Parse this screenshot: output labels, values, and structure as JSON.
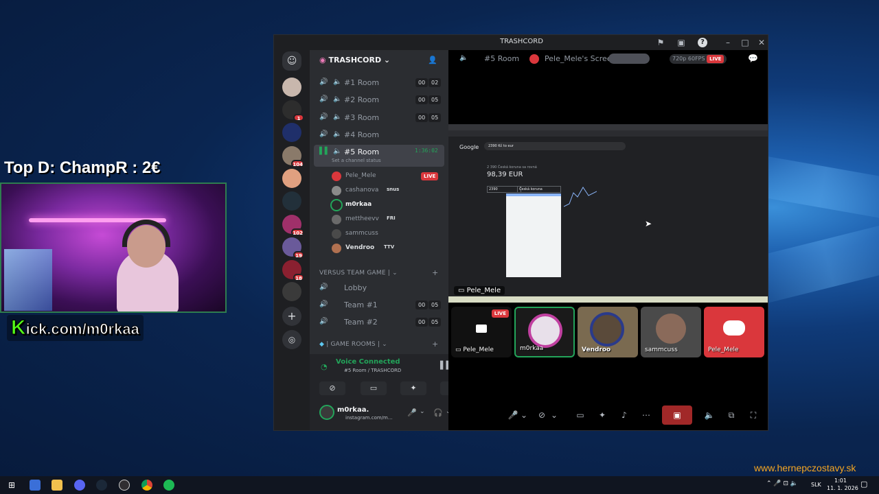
{
  "overlay": {
    "title": "Top D: ChampR : 2€",
    "kick_k": "K",
    "kick_rest": "ick.com/m0rkaa",
    "website": "www.hernepczostavy.sk"
  },
  "window": {
    "title": "TRASHCORD"
  },
  "servers": [
    {
      "badge": ""
    },
    {
      "badge": "1"
    },
    {
      "badge": ""
    },
    {
      "badge": "104"
    },
    {
      "badge": ""
    },
    {
      "badge": ""
    },
    {
      "badge": "102"
    },
    {
      "badge": "19"
    },
    {
      "badge": "18"
    },
    {
      "badge": ""
    }
  ],
  "sidebar": {
    "guild_name": "TRASHCORD",
    "channels": [
      {
        "name": "#1 Room",
        "count_a": "00",
        "count_b": "02"
      },
      {
        "name": "#2 Room",
        "count_a": "00",
        "count_b": "05"
      },
      {
        "name": "#3 Room",
        "count_a": "00",
        "count_b": "05"
      },
      {
        "name": "#4 Room",
        "count_a": "",
        "count_b": ""
      }
    ],
    "active_channel": {
      "name": "#5 Room",
      "timer": "1:36:02",
      "status": "Set a channel status"
    },
    "voice_users": [
      {
        "name": "Pele_Mele",
        "tag": "LIVE"
      },
      {
        "name": "cashanova",
        "tag": "snus"
      },
      {
        "name": "m0rkaa",
        "tag": ""
      },
      {
        "name": "mettheevv",
        "tag": "FRI"
      },
      {
        "name": "sammcuss",
        "tag": ""
      },
      {
        "name": "Vendroo",
        "tag": "TTV"
      }
    ],
    "category_versus": "VERSUS TEAM GAME |",
    "versus_channels": [
      {
        "name": "Lobby",
        "count_a": "",
        "count_b": ""
      },
      {
        "name": "Team #1",
        "count_a": "00",
        "count_b": "05"
      },
      {
        "name": "Team #2",
        "count_a": "00",
        "count_b": "05"
      }
    ],
    "category_game": "| GAME ROOMS |"
  },
  "voice": {
    "status": "Voice Connected",
    "location": "#5 Room / TRASHCORD"
  },
  "user": {
    "name": "m0rkaa.",
    "subtitle": "instagram.com/m..."
  },
  "stage": {
    "channel": "#5 Room",
    "stream_title": "Pele_Mele's Screen",
    "quality": "720p 60FPS",
    "live": "LIVE",
    "stream_owner": "Pele_Mele",
    "inner": {
      "search": "2390 Kč to eur",
      "result_label": "2 390 Česká koruna sa rovná",
      "result_value": "98,39 EUR",
      "input_value": "2390",
      "currency": "Česká koruna",
      "google": "Google"
    }
  },
  "tiles": [
    {
      "name": "Pele_Mele",
      "live": "LIVE"
    },
    {
      "name": "m0rkaa",
      "live": ""
    },
    {
      "name": "Vendroo",
      "live": ""
    },
    {
      "name": "sammcuss",
      "live": ""
    },
    {
      "name": "Pele_Mele",
      "live": ""
    }
  ],
  "taskbar": {
    "lang": "SLK",
    "time": "1:01",
    "date": "11. 1. 2026"
  },
  "colors": {
    "accent": "#5865f2",
    "live": "#da373c",
    "voice_green": "#23a55a",
    "kick_green": "#53fc18"
  }
}
